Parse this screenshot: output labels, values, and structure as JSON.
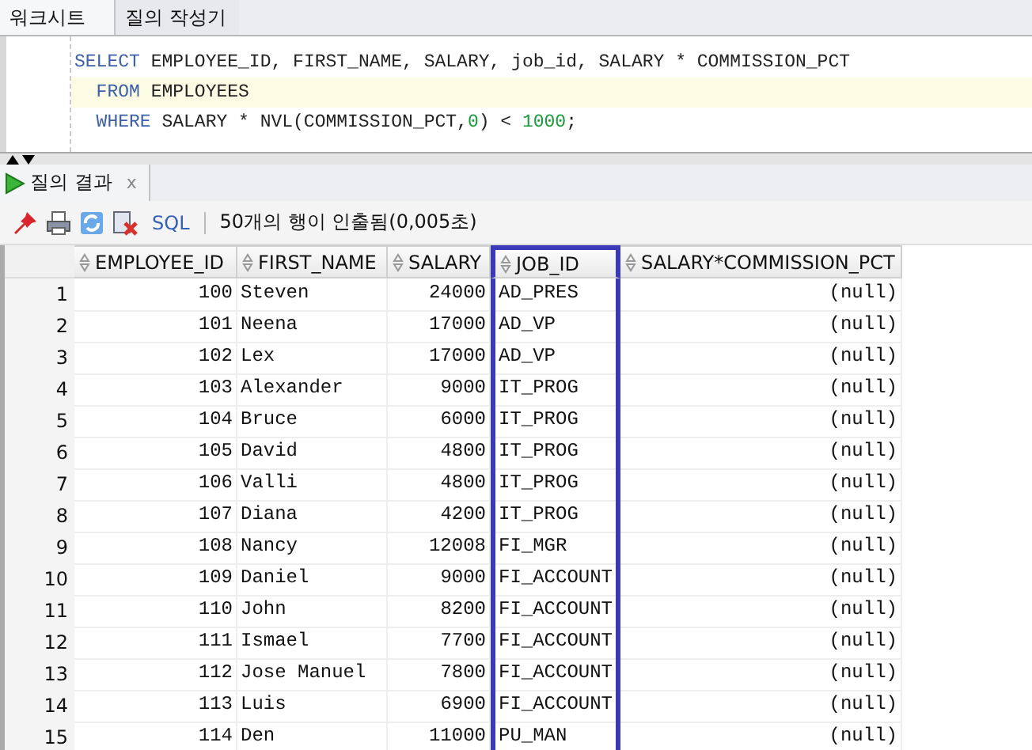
{
  "editor_tabs": [
    {
      "label": "워크시트",
      "selected": true
    },
    {
      "label": "질의 작성기",
      "selected": false
    }
  ],
  "sql_lines": [
    {
      "current": false,
      "tokens": [
        {
          "text": "SELECT",
          "kind": "keyword"
        },
        {
          "text": " EMPLOYEE_ID, FIRST_NAME, SALARY, job_id, SALARY * COMMISSION_PCT",
          "kind": "plain"
        }
      ]
    },
    {
      "current": true,
      "tokens": [
        {
          "text": "  FROM",
          "kind": "keyword"
        },
        {
          "text": " EMPLOYEES",
          "kind": "plain"
        }
      ]
    },
    {
      "current": false,
      "tokens": [
        {
          "text": "  WHERE",
          "kind": "keyword"
        },
        {
          "text": " SALARY * NVL(COMMISSION_PCT,",
          "kind": "plain"
        },
        {
          "text": "0",
          "kind": "number"
        },
        {
          "text": ") < ",
          "kind": "plain"
        },
        {
          "text": "1000",
          "kind": "number"
        },
        {
          "text": ";",
          "kind": "plain"
        }
      ]
    }
  ],
  "result_tab": {
    "label": "질의 결과",
    "close": "x"
  },
  "toolbar": {
    "sql_link": "SQL",
    "status": "50개의 행이 인출됨(0,005초)"
  },
  "table": {
    "columns": [
      {
        "label": "EMPLOYEE_ID",
        "kind": "number",
        "highlighted": false
      },
      {
        "label": "FIRST_NAME",
        "kind": "text",
        "highlighted": false
      },
      {
        "label": "SALARY",
        "kind": "number",
        "highlighted": false
      },
      {
        "label": "JOB_ID",
        "kind": "text",
        "highlighted": true
      },
      {
        "label": "SALARY*COMMISSION_PCT",
        "kind": "number",
        "highlighted": false
      }
    ],
    "rows": [
      {
        "num": "1",
        "cells": [
          "100",
          "Steven",
          "24000",
          "AD_PRES",
          "(null)"
        ]
      },
      {
        "num": "2",
        "cells": [
          "101",
          "Neena",
          "17000",
          "AD_VP",
          "(null)"
        ]
      },
      {
        "num": "3",
        "cells": [
          "102",
          "Lex",
          "17000",
          "AD_VP",
          "(null)"
        ]
      },
      {
        "num": "4",
        "cells": [
          "103",
          "Alexander",
          "9000",
          "IT_PROG",
          "(null)"
        ]
      },
      {
        "num": "5",
        "cells": [
          "104",
          "Bruce",
          "6000",
          "IT_PROG",
          "(null)"
        ]
      },
      {
        "num": "6",
        "cells": [
          "105",
          "David",
          "4800",
          "IT_PROG",
          "(null)"
        ]
      },
      {
        "num": "7",
        "cells": [
          "106",
          "Valli",
          "4800",
          "IT_PROG",
          "(null)"
        ]
      },
      {
        "num": "8",
        "cells": [
          "107",
          "Diana",
          "4200",
          "IT_PROG",
          "(null)"
        ]
      },
      {
        "num": "9",
        "cells": [
          "108",
          "Nancy",
          "12008",
          "FI_MGR",
          "(null)"
        ]
      },
      {
        "num": "10",
        "cells": [
          "109",
          "Daniel",
          "9000",
          "FI_ACCOUNT",
          "(null)"
        ]
      },
      {
        "num": "11",
        "cells": [
          "110",
          "John",
          "8200",
          "FI_ACCOUNT",
          "(null)"
        ]
      },
      {
        "num": "12",
        "cells": [
          "111",
          "Ismael",
          "7700",
          "FI_ACCOUNT",
          "(null)"
        ]
      },
      {
        "num": "13",
        "cells": [
          "112",
          "Jose Manuel",
          "7800",
          "FI_ACCOUNT",
          "(null)"
        ]
      },
      {
        "num": "14",
        "cells": [
          "113",
          "Luis",
          "6900",
          "FI_ACCOUNT",
          "(null)"
        ]
      },
      {
        "num": "15",
        "cells": [
          "114",
          "Den",
          "11000",
          "PU_MAN",
          "(null)"
        ]
      }
    ]
  }
}
